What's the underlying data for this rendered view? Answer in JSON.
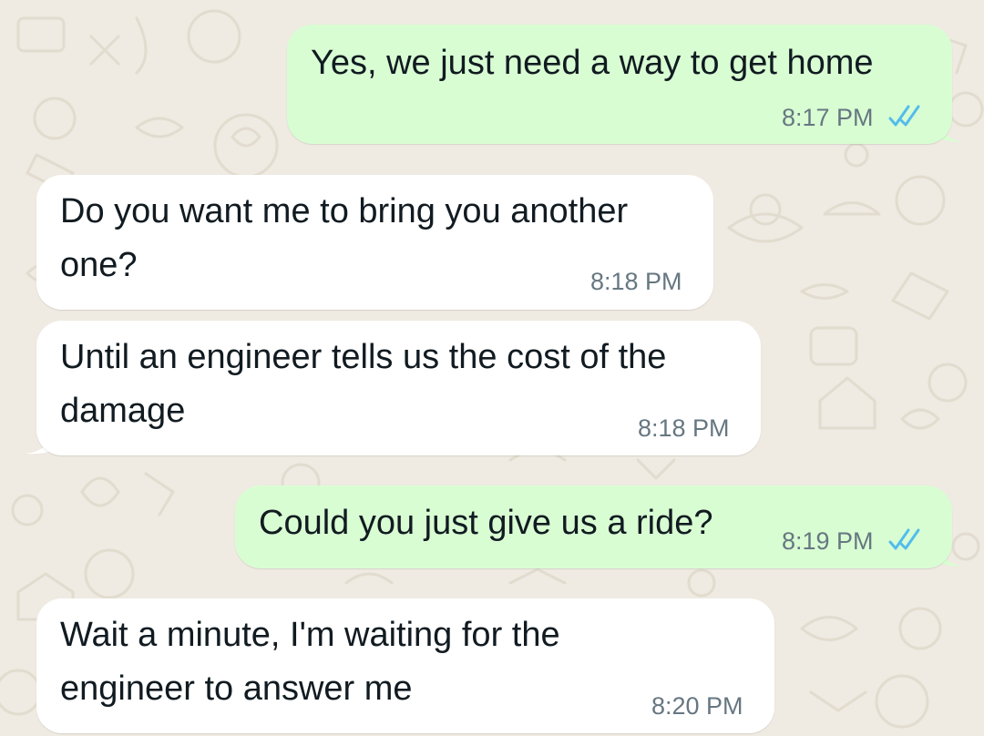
{
  "chat": {
    "messages": [
      {
        "direction": "outgoing",
        "text_lines": [
          "Yes, we just need a way to get home"
        ],
        "time": "8:17 PM",
        "status": "read",
        "status_icon": "double-check-icon"
      },
      {
        "direction": "incoming",
        "text_lines": [
          "Do you want me to bring you another",
          "one?"
        ],
        "time": "8:18 PM"
      },
      {
        "direction": "incoming",
        "text_lines": [
          "Until an engineer tells us the cost of the",
          "damage"
        ],
        "time": "8:18 PM"
      },
      {
        "direction": "outgoing",
        "text_lines": [
          "Could you just give us a ride?"
        ],
        "time": "8:19 PM",
        "status": "read",
        "status_icon": "double-check-icon"
      },
      {
        "direction": "incoming",
        "text_lines": [
          "Wait a minute, I'm waiting for the",
          "engineer to answer me"
        ],
        "time": "8:20 PM"
      }
    ]
  },
  "colors": {
    "background": "#efeae2",
    "outgoing_bubble": "#d9fdd3",
    "incoming_bubble": "#ffffff",
    "text": "#111b21",
    "timestamp": "#667781",
    "read_tick": "#53bdeb"
  }
}
